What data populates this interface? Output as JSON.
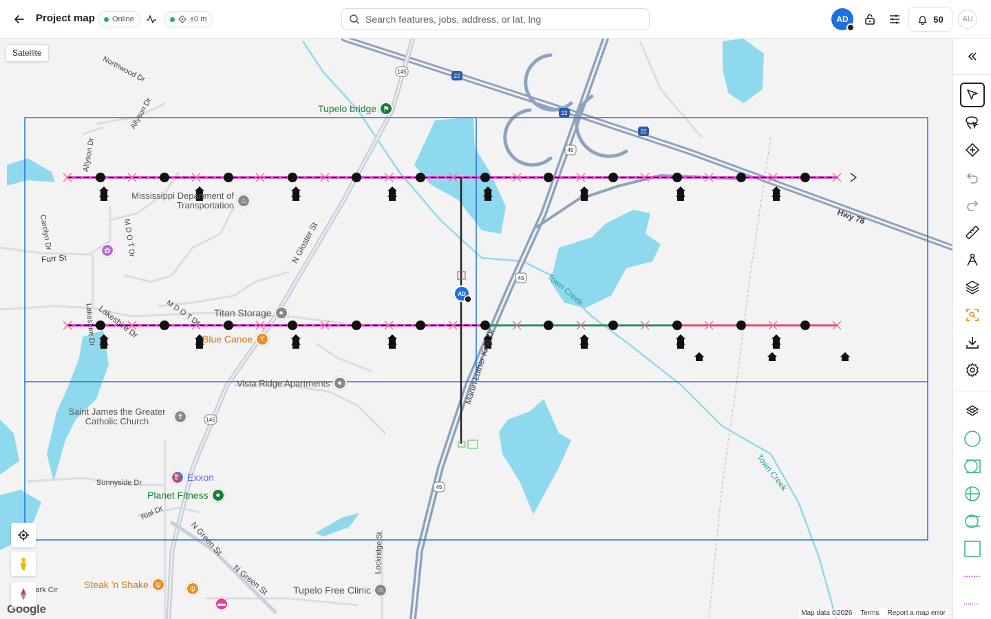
{
  "header": {
    "title": "Project map",
    "status": "Online",
    "accuracy": "±0 m",
    "search_placeholder": "Search features, jobs, address, or lat, lng",
    "user_initials": "AD",
    "notifications": "50",
    "account_initials": "AU"
  },
  "map": {
    "satellite_label": "Satellite",
    "places": [
      {
        "name": "Tupelo bridge",
        "color": "#188038",
        "icon": "hiker-icon"
      },
      {
        "name": "Mississippi Department of Transportation",
        "color": "#777777",
        "icon": "government-icon"
      },
      {
        "name": "Titan Storage",
        "color": "#777777",
        "icon": "pin-icon"
      },
      {
        "name": "Blue Canoe",
        "color": "#f28c1b",
        "icon": "bar-icon"
      },
      {
        "name": "Vista Ridge Apartments",
        "color": "#777777",
        "icon": "pin-icon"
      },
      {
        "name": "Saint James the Greater Catholic Church",
        "color": "#777777",
        "icon": "cross-icon"
      },
      {
        "name": "Exxon",
        "color": "#5b6ee1",
        "icon": "fuel-icon"
      },
      {
        "name": "Planet Fitness",
        "color": "#188038",
        "icon": "fitness-icon"
      },
      {
        "name": "Steak 'n Shake",
        "color": "#f28c1b",
        "icon": "food-icon"
      },
      {
        "name": "Tupelo Free Clinic",
        "color": "#777777",
        "icon": "clinic-icon"
      }
    ],
    "streets": [
      "Northwood Dr",
      "Allyson Dr",
      "Allyson Dr",
      "Carolyn Dr",
      "M D O T Dr",
      "Furr St",
      "N Gloster St",
      "Lakeshire Dr",
      "M D O T Dr",
      "Lakeshire Dr",
      "Sunnyside Dr",
      "Rial Dr",
      "N Green St",
      "N Green St",
      "Lockridge St",
      "Martin Luther King Dr",
      "Town Creek",
      "Town Creek",
      "Hwy 78",
      "Park Cir"
    ],
    "shields": [
      "145",
      "22",
      "22",
      "22",
      "45",
      "45",
      "45",
      "145"
    ],
    "user_marker": "AD",
    "google": "Google",
    "footer": {
      "map_data": "Map data ©2026",
      "terms": "Terms",
      "report": "Report a map error"
    }
  },
  "toolbar": {
    "tools": [
      "collapse-icon",
      "select-pointer-icon",
      "lasso-select-icon",
      "add-node-icon",
      "undo-icon",
      "redo-icon",
      "measure-icon",
      "draw-line-icon",
      "layers-icon",
      "focus-icon",
      "download-icon",
      "settings-icon",
      "layer-stack-icon",
      "circle-tool-icon",
      "shape-tool-1-icon",
      "shape-tool-2-icon",
      "shape-tool-3-icon",
      "rectangle-tool-icon",
      "line-style-1-icon",
      "line-style-2-icon"
    ]
  },
  "colors": {
    "accent": "#1f6fe0",
    "magenta": "#e83ad4",
    "green": "#2e8b57",
    "pink": "#e8456b",
    "water": "#8fd9ee",
    "grid": "#1f6fe0"
  }
}
